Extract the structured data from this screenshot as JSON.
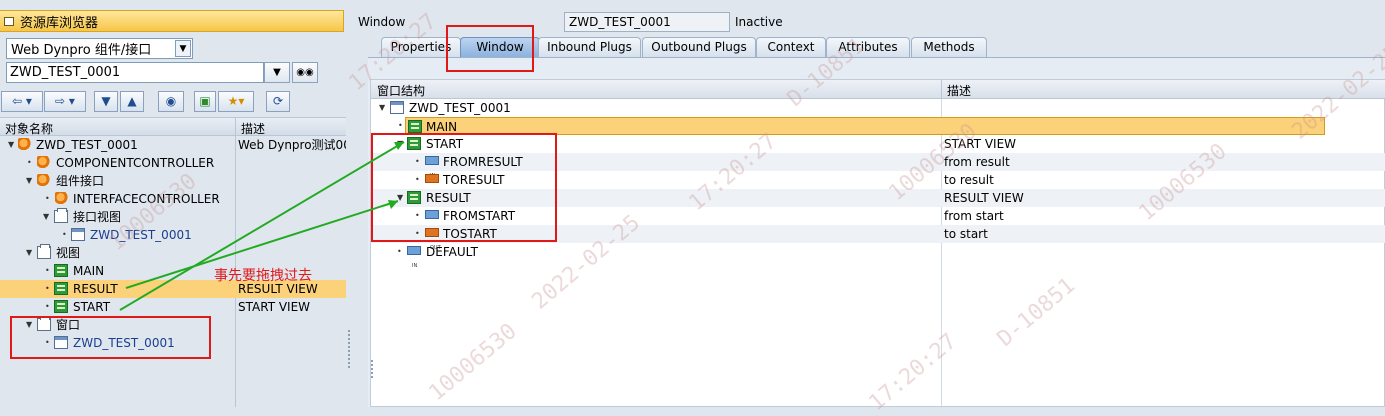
{
  "left": {
    "title": "资源库浏览器",
    "object_type_select": "Web Dynpro 组件/接口",
    "object_input": "ZWD_TEST_0001",
    "columns": {
      "name": "对象名称",
      "desc": "描述"
    },
    "tree": [
      {
        "label": "ZWD_TEST_0001",
        "desc": "Web Dynpro测试00"
      },
      {
        "label": "COMPONENTCONTROLLER",
        "desc": ""
      },
      {
        "label": "组件接口",
        "desc": ""
      },
      {
        "label": "INTERFACECONTROLLER",
        "desc": ""
      },
      {
        "label": "接口视图",
        "desc": ""
      },
      {
        "label": "ZWD_TEST_0001",
        "desc": ""
      },
      {
        "label": "视图",
        "desc": ""
      },
      {
        "label": "MAIN",
        "desc": ""
      },
      {
        "label": "RESULT",
        "desc": "RESULT VIEW"
      },
      {
        "label": "START",
        "desc": "START VIEW"
      },
      {
        "label": "窗口",
        "desc": ""
      },
      {
        "label": "ZWD_TEST_0001",
        "desc": ""
      }
    ]
  },
  "right": {
    "window_label": "Window",
    "window_name": "ZWD_TEST_0001",
    "window_status": "Inactive",
    "tabs": [
      "Properties",
      "Window",
      "Inbound Plugs",
      "Outbound Plugs",
      "Context",
      "Attributes",
      "Methods"
    ],
    "grid_columns": {
      "structure": "窗口结构",
      "desc": "描述"
    },
    "grid": [
      {
        "label": "ZWD_TEST_0001",
        "desc": ""
      },
      {
        "label": "MAIN",
        "desc": ""
      },
      {
        "label": "START",
        "desc": "START VIEW"
      },
      {
        "label": "FROMRESULT",
        "desc": "from result"
      },
      {
        "label": "TORESULT",
        "desc": "to result"
      },
      {
        "label": "RESULT",
        "desc": "RESULT VIEW"
      },
      {
        "label": "FROMSTART",
        "desc": "from start"
      },
      {
        "label": "TOSTART",
        "desc": "to start"
      },
      {
        "label": "DEFAULT",
        "desc": ""
      }
    ]
  },
  "plug_icon_labels": {
    "in": "IN",
    "out": "OUT"
  },
  "annotation": "事先要拖拽过去",
  "watermark": [
    "10006530",
    "2022-02-25",
    "17:20:27",
    "D-10851"
  ],
  "colors": {
    "highlight": "#fbd17a",
    "annotation": "#e01818",
    "arrow": "#22aa22"
  }
}
